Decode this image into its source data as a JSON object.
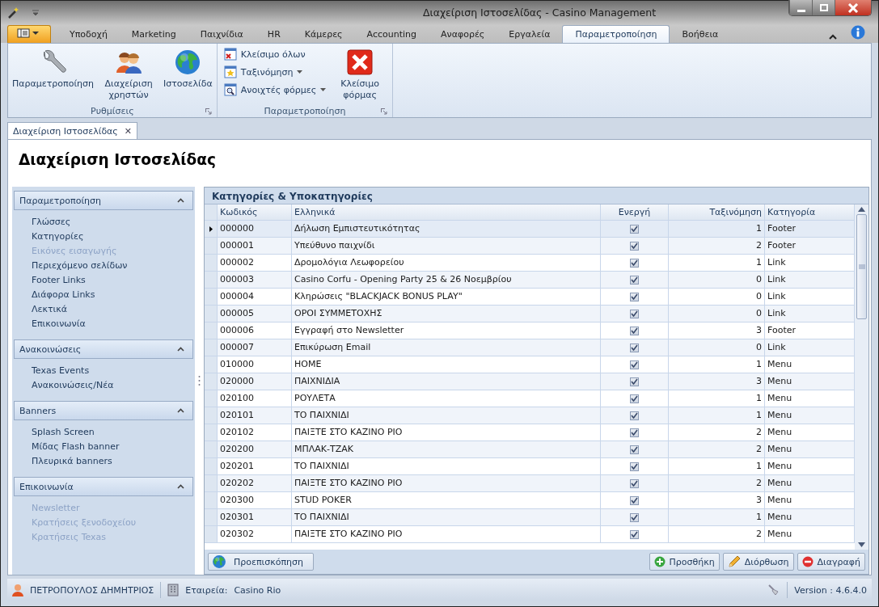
{
  "window": {
    "title": "Διαχείριση Ιστοσελίδας - Casino Management"
  },
  "ribbon_tabs": [
    {
      "label": "Υποδοχή",
      "selected": false
    },
    {
      "label": "Marketing",
      "selected": false
    },
    {
      "label": "Παιχνίδια",
      "selected": false
    },
    {
      "label": "HR",
      "selected": false
    },
    {
      "label": "Κάμερες",
      "selected": false
    },
    {
      "label": "Accounting",
      "selected": false
    },
    {
      "label": "Αναφορές",
      "selected": false
    },
    {
      "label": "Εργαλεία",
      "selected": false
    },
    {
      "label": "Παραμετροποίηση",
      "selected": true
    },
    {
      "label": "Βοήθεια",
      "selected": false
    }
  ],
  "ribbon_groups": [
    {
      "caption": "Ρυθμίσεις",
      "items": [
        {
          "kind": "large",
          "label": "Παραμετροποίηση"
        },
        {
          "kind": "large",
          "label": "Διαχείριση χρηστών"
        },
        {
          "kind": "large",
          "label": "Ιστοσελίδα"
        }
      ]
    },
    {
      "caption": "Παραμετροποίηση",
      "items": [
        {
          "kind": "small",
          "label": "Κλείσιμο όλων",
          "dropdown": false
        },
        {
          "kind": "small",
          "label": "Ταξινόμηση",
          "dropdown": true
        },
        {
          "kind": "small",
          "label": "Ανοιχτές φόρμες",
          "dropdown": true
        },
        {
          "kind": "large",
          "label": "Κλείσιμο φόρμας"
        }
      ]
    }
  ],
  "document_tab": {
    "label": "Διαχείριση Ιστοσελίδας",
    "close": "✕"
  },
  "page_title": "Διαχείριση Ιστοσελίδας",
  "sidebar": [
    {
      "title": "Παραμετροποίηση",
      "expanded": true,
      "items": [
        {
          "label": "Γλώσσες",
          "disabled": false
        },
        {
          "label": "Κατηγορίες",
          "disabled": false
        },
        {
          "label": "Εικόνες εισαγωγής",
          "disabled": true
        },
        {
          "label": "Περιεχόμενο σελίδων",
          "disabled": false
        },
        {
          "label": "Footer Links",
          "disabled": false
        },
        {
          "label": "Διάφορα Links",
          "disabled": false
        },
        {
          "label": "Λεκτικά",
          "disabled": false
        },
        {
          "label": "Επικοινωνία",
          "disabled": false
        }
      ]
    },
    {
      "title": "Ανακοινώσεις",
      "expanded": true,
      "items": [
        {
          "label": "Texas Events",
          "disabled": false
        },
        {
          "label": "Ανακοινώσεις/Νέα",
          "disabled": false
        }
      ]
    },
    {
      "title": "Banners",
      "expanded": true,
      "items": [
        {
          "label": "Splash Screen",
          "disabled": false
        },
        {
          "label": "Μίδας Flash banner",
          "disabled": false
        },
        {
          "label": "Πλευρικά banners",
          "disabled": false
        }
      ]
    },
    {
      "title": "Επικοινωνία",
      "expanded": true,
      "items": [
        {
          "label": "Newsletter",
          "disabled": true
        },
        {
          "label": "Κρατήσεις ξενοδοχείου",
          "disabled": true
        },
        {
          "label": "Κρατήσεις Texas",
          "disabled": true
        }
      ]
    }
  ],
  "table": {
    "title": "Κατηγορίες & Υποκατηγορίες",
    "columns": [
      "Κωδικός",
      "Ελληνικά",
      "Ενεργή",
      "Ταξινόμηση",
      "Κατηγορία"
    ],
    "rows": [
      {
        "code": "000000",
        "name": "Δήλωση Εμπιστευτικότητας",
        "active": true,
        "order": "1",
        "category": "Footer",
        "selected": true
      },
      {
        "code": "000001",
        "name": "Υπεύθυνο παιχνίδι",
        "active": true,
        "order": "2",
        "category": "Footer",
        "selected": false
      },
      {
        "code": "000002",
        "name": "Δρομολόγια Λεωφορείου",
        "active": true,
        "order": "1",
        "category": "Link",
        "selected": false
      },
      {
        "code": "000003",
        "name": "Casino Corfu - Opening Party 25 & 26 Νοεμβρίου",
        "active": true,
        "order": "0",
        "category": "Link",
        "selected": false
      },
      {
        "code": "000004",
        "name": "Κληρώσεις \"BLACKJACK BONUS PLAY\"",
        "active": true,
        "order": "0",
        "category": "Link",
        "selected": false
      },
      {
        "code": "000005",
        "name": "ΟΡΟΙ ΣΥΜΜΕΤΟΧΗΣ",
        "active": true,
        "order": "0",
        "category": "Link",
        "selected": false
      },
      {
        "code": "000006",
        "name": "Εγγραφή στο Newsletter",
        "active": true,
        "order": "3",
        "category": "Footer",
        "selected": false
      },
      {
        "code": "000007",
        "name": "Επικύρωση Email",
        "active": true,
        "order": "0",
        "category": "Link",
        "selected": false
      },
      {
        "code": "010000",
        "name": "HOME",
        "active": true,
        "order": "1",
        "category": "Menu",
        "selected": false
      },
      {
        "code": "020000",
        "name": "ΠΑΙΧΝΙΔΙΑ",
        "active": true,
        "order": "3",
        "category": "Menu",
        "selected": false
      },
      {
        "code": "020100",
        "name": "ΡΟΥΛΕΤΑ",
        "active": true,
        "order": "1",
        "category": "Menu",
        "selected": false
      },
      {
        "code": "020101",
        "name": "ΤΟ ΠΑΙΧΝΙΔΙ",
        "active": true,
        "order": "1",
        "category": "Menu",
        "selected": false
      },
      {
        "code": "020102",
        "name": "ΠΑΙΞΤΕ ΣΤΟ ΚΑΖΙΝΟ ΡΙΟ",
        "active": true,
        "order": "2",
        "category": "Menu",
        "selected": false
      },
      {
        "code": "020200",
        "name": "ΜΠΛΑΚ-ΤΖΑΚ",
        "active": true,
        "order": "2",
        "category": "Menu",
        "selected": false
      },
      {
        "code": "020201",
        "name": "ΤΟ ΠΑΙΧΝΙΔΙ",
        "active": true,
        "order": "1",
        "category": "Menu",
        "selected": false
      },
      {
        "code": "020202",
        "name": "ΠΑΙΞΤΕ ΣΤΟ ΚΑΖΙΝΟ ΡΙΟ",
        "active": true,
        "order": "2",
        "category": "Menu",
        "selected": false
      },
      {
        "code": "020300",
        "name": "STUD POKER",
        "active": true,
        "order": "3",
        "category": "Menu",
        "selected": false
      },
      {
        "code": "020301",
        "name": "ΤΟ ΠΑΙΧΝΙΔΙ",
        "active": true,
        "order": "1",
        "category": "Menu",
        "selected": false
      },
      {
        "code": "020302",
        "name": "ΠΑΙΞΤΕ ΣΤΟ ΚΑΖΙΝΟ ΡΙΟ",
        "active": true,
        "order": "2",
        "category": "Menu",
        "selected": false
      }
    ]
  },
  "actions_left": [
    {
      "label": "Προεπισκόπηση"
    }
  ],
  "actions_right": [
    {
      "label": "Προσθήκη"
    },
    {
      "label": "Διόρθωση"
    },
    {
      "label": "Διαγραφή"
    }
  ],
  "status_bar": {
    "user": "ΠΕΤΡΟΠΟΥΛΟΣ ΔΗΜΗΤΡΙΟΣ",
    "company_label": "Εταιρεία:",
    "company": "Casino Rio",
    "version": "Version : 4.6.4.0"
  }
}
